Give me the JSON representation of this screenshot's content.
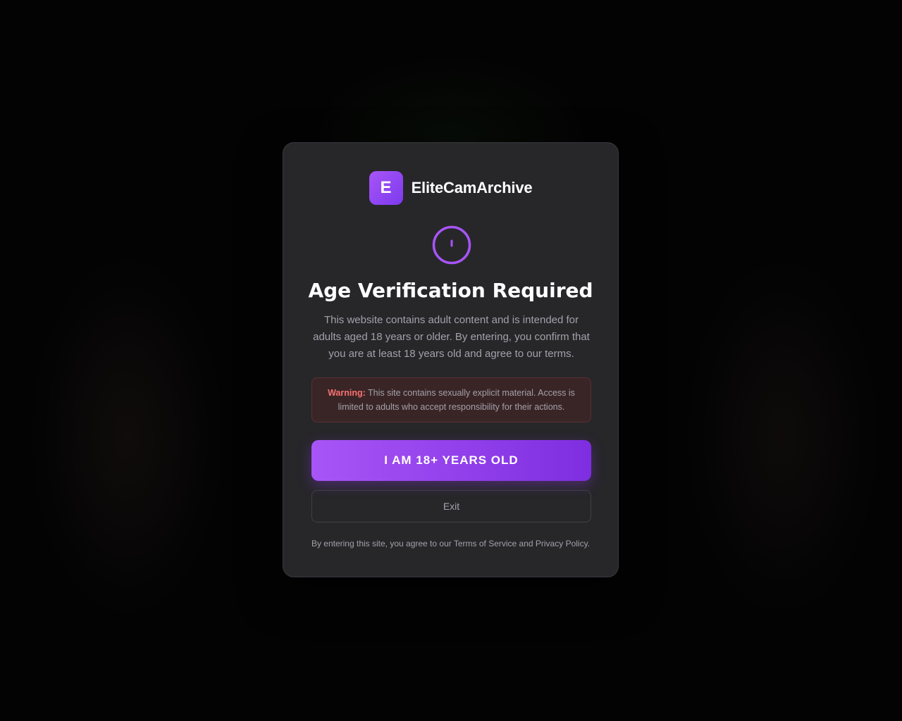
{
  "brand": {
    "logo_letter": "E",
    "name": "EliteCamArchive",
    "accent_color": "#a855f7"
  },
  "modal": {
    "icon": "alert-circle-icon",
    "title": "Age Verification Required",
    "description": "This website contains adult content and is intended for adults aged 18 years or older. By entering, you confirm that you are at least 18 years old and agree to our terms.",
    "warning": {
      "label": "Warning:",
      "text": "This site contains sexually explicit material. Access is limited to adults who accept responsibility for their actions.",
      "color": "#f87171"
    },
    "enter_button_label": "I AM 18+ YEARS OLD",
    "exit_button_label": "Exit",
    "footer_note": "By entering this site, you agree to our Terms of Service and Privacy Policy."
  }
}
